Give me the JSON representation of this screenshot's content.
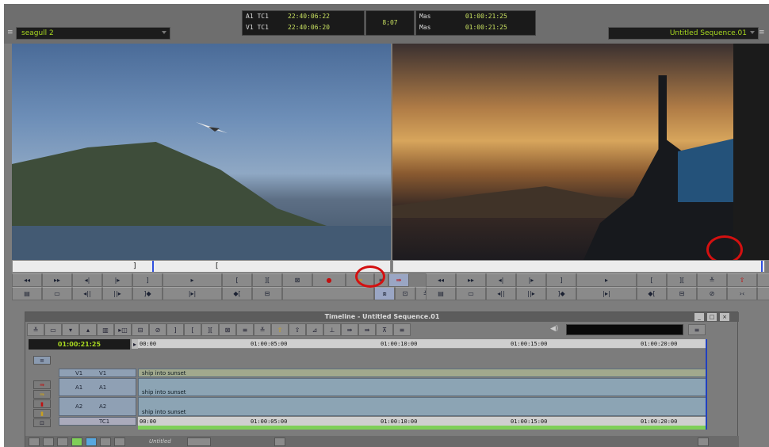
{
  "source_clip": {
    "name": "seagull 2"
  },
  "record_sequence": {
    "name": "Untitled Sequence.01"
  },
  "timecode_panel": {
    "rows": [
      {
        "label": "A1 TC1",
        "value": "22:40:06:22"
      },
      {
        "label": "V1 TC1",
        "value": "22:40:06:20"
      }
    ],
    "duration": "8;07",
    "record_rows": [
      {
        "label": "Mas",
        "value": "01:00:21:25"
      },
      {
        "label": "Mas",
        "value": "01:00:21:25"
      }
    ]
  },
  "timeline": {
    "title": "Timeline - Untitled Sequence.01",
    "current_tc": "01:00:21:25",
    "ruler_labels": [
      "00:00",
      "01:00:05:00",
      "01:00:10:00",
      "01:00:15:00",
      "01:00:20:00"
    ],
    "tracks": [
      {
        "rec": "V1",
        "src": "V1",
        "clip": "ship into sunset"
      },
      {
        "rec": "A1",
        "src": "A1",
        "clip": "ship into sunset"
      },
      {
        "rec": "A2",
        "src": "A2",
        "clip": "ship into sunset"
      }
    ],
    "tc_track": "TC1",
    "status_label": "Untitled",
    "win_buttons": [
      "_",
      "□",
      "×"
    ]
  },
  "colors": {
    "annotation_circle": "#d41010",
    "timecode_text": "#a8d820"
  }
}
